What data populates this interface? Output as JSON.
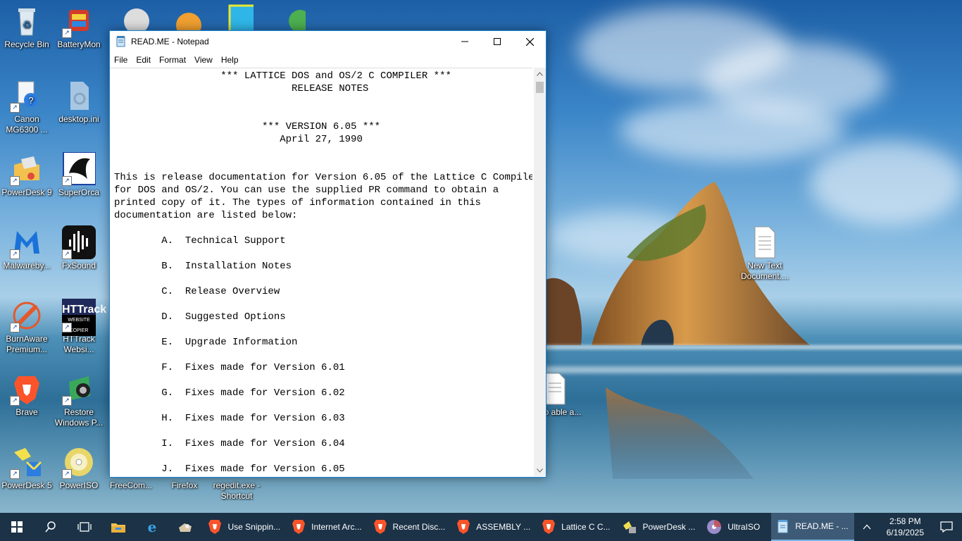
{
  "desktop": {
    "icons": [
      {
        "label": "Recycle Bin",
        "icon": "recycle-bin-icon"
      },
      {
        "label": "BatteryMon",
        "icon": "batterymon-icon"
      },
      {
        "label": "Canon MG6300 ...",
        "icon": "printer-icon"
      },
      {
        "label": "desktop.ini",
        "icon": "settings-file-icon"
      },
      {
        "label": "PowerDesk 9",
        "icon": "powerdesk-icon"
      },
      {
        "label": "SuperOrca",
        "icon": "orca-icon"
      },
      {
        "label": "Malwareby...",
        "icon": "malwarebytes-icon"
      },
      {
        "label": "FxSound",
        "icon": "fxsound-icon"
      },
      {
        "label": "BurnAware Premium...",
        "icon": "burnaware-icon"
      },
      {
        "label": "HTTrack Websi...",
        "icon": "httrack-icon"
      },
      {
        "label": "Brave",
        "icon": "brave-icon"
      },
      {
        "label": "Restore Windows P...",
        "icon": "restore-icon"
      },
      {
        "label": "PowerDesk 5",
        "icon": "powerdesk5-icon"
      },
      {
        "label": "PowerISO",
        "icon": "poweriso-icon"
      },
      {
        "label": "FreeCom...",
        "icon": "freecom-icon"
      },
      {
        "label": "Firefox",
        "icon": "firefox-icon"
      },
      {
        "label": "regedit.exe - Shortcut",
        "icon": "regedit-icon"
      },
      {
        "label": "New Text Document....",
        "icon": "text-file-icon"
      },
      {
        "label": "ow to able a...",
        "icon": "text-file-icon"
      }
    ],
    "httrack_text": "HTTrack",
    "httrack_sub": "WEBSITE COPIER"
  },
  "notepad": {
    "title": "READ.ME - Notepad",
    "menu": [
      "File",
      "Edit",
      "Format",
      "View",
      "Help"
    ],
    "content": "                  *** LATTICE DOS and OS/2 C COMPILER ***\n                              RELEASE NOTES\n\n\n                         *** VERSION 6.05 ***\n                            April 27, 1990\n\n\nThis is release documentation for Version 6.05 of the Lattice C Compiler\nfor DOS and OS/2. You can use the supplied PR command to obtain a\nprinted copy of it. The types of information contained in this\ndocumentation are listed below:\n\n        A.  Technical Support\n\n        B.  Installation Notes\n\n        C.  Release Overview\n\n        D.  Suggested Options\n\n        E.  Upgrade Information\n\n        F.  Fixes made for Version 6.01\n\n        G.  Fixes made for Version 6.02\n\n        H.  Fixes made for Version 6.03\n\n        I.  Fixes made for Version 6.04\n\n        J.  Fixes made for Version 6.05"
  },
  "taskbar": {
    "apps": [
      {
        "label": "Use Snippin...",
        "icon": "brave-icon",
        "active": false
      },
      {
        "label": "Internet Arc...",
        "icon": "brave-icon",
        "active": false
      },
      {
        "label": "Recent Disc...",
        "icon": "brave-icon",
        "active": false
      },
      {
        "label": "ASSEMBLY ...",
        "icon": "brave-icon",
        "active": false
      },
      {
        "label": "Lattice C C...",
        "icon": "brave-icon",
        "active": false
      },
      {
        "label": "PowerDesk ...",
        "icon": "powerdesk-icon",
        "active": false
      },
      {
        "label": "UltraISO",
        "icon": "ultraiso-icon",
        "active": false
      },
      {
        "label": "READ.ME - ...",
        "icon": "notepad-icon",
        "active": true
      }
    ],
    "time": "2:58 PM",
    "date": "6/19/2025"
  }
}
